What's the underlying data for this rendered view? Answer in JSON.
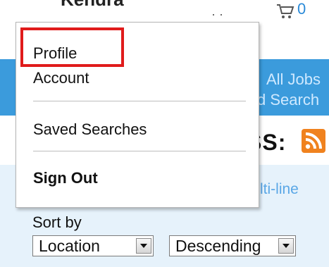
{
  "header": {
    "username": "Kendra",
    "cart_count": "0",
    "dots": "· ·"
  },
  "blue_band": {
    "link1": "All Jobs",
    "link2": "d Search"
  },
  "rss": {
    "label": "SS:"
  },
  "panel": {
    "multiline_text": "lti-line",
    "sort_label": "Sort by",
    "sort_field_value": "Location",
    "sort_order_value": "Descending"
  },
  "menu": {
    "items": [
      {
        "label": "Profile"
      },
      {
        "label": "Account"
      },
      {
        "label": "Saved Searches"
      },
      {
        "label": "Sign Out"
      }
    ]
  },
  "colors": {
    "accent_blue": "#3b9bdc",
    "highlight_red": "#e01b1b",
    "rss_orange": "#f0821e"
  },
  "icons": {
    "cart": "shopping-cart-icon",
    "rss": "rss-icon",
    "dropdown": "chevron-down-icon"
  }
}
